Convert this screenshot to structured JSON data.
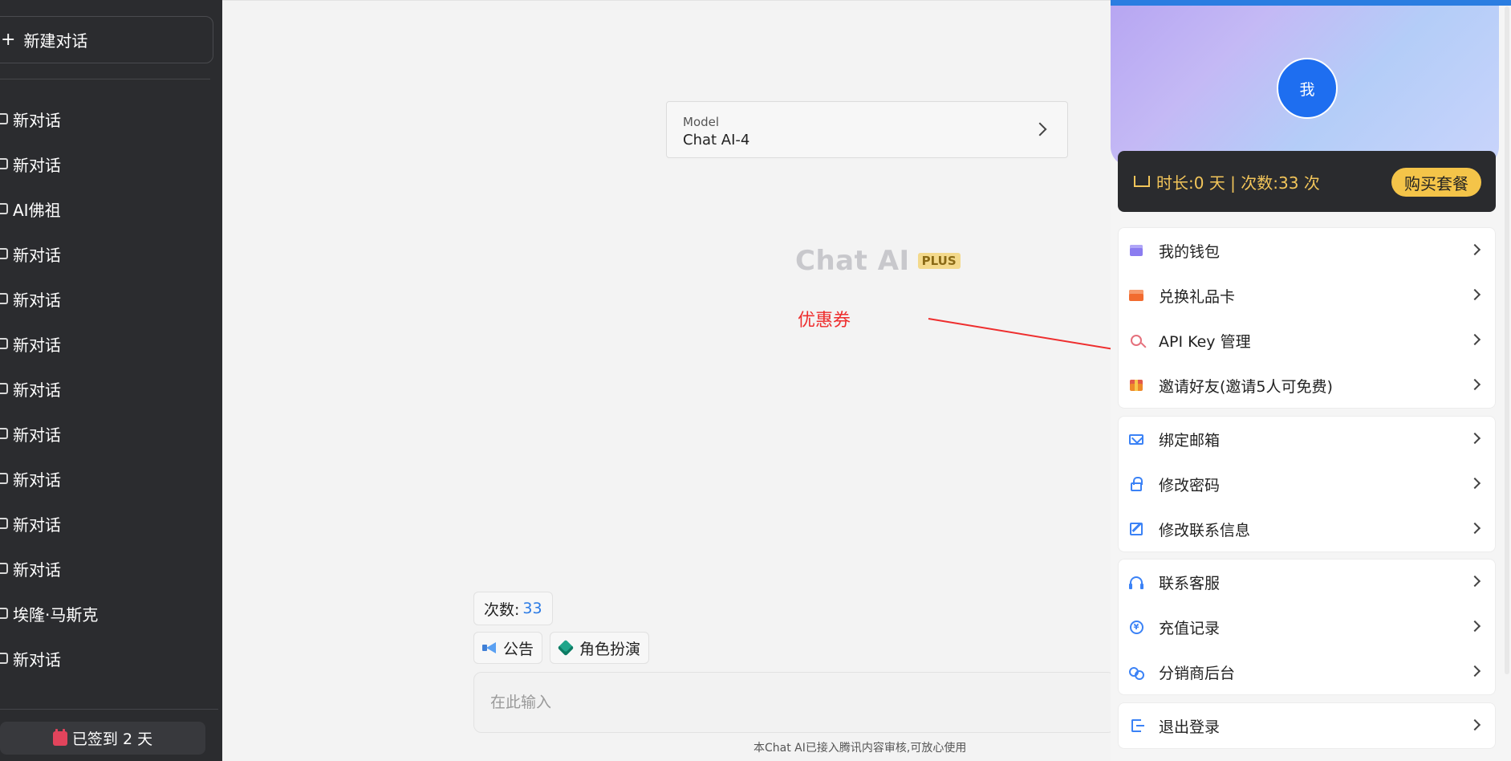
{
  "sidebar": {
    "new_chat_label": "新建对话",
    "new_chat_icon": "+",
    "chats": [
      "新对话",
      "新对话",
      "AI佛祖",
      "新对话",
      "新对话",
      "新对话",
      "新对话",
      "新对话",
      "新对话",
      "新对话",
      "新对话",
      "埃隆·马斯克",
      "新对话"
    ],
    "checkin_label": "已签到 2 天"
  },
  "main": {
    "model_label": "Model",
    "model_value": "Chat AI-4",
    "brand_title": "Chat AI",
    "brand_badge": "PLUS",
    "annotation": "优惠券",
    "count_label": "次数:",
    "count_value": "33",
    "announce_label": "公告",
    "role_label": "角色扮演",
    "input_placeholder": "在此输入",
    "footer_note": "本Chat AI已接入腾讯内容审核,可放心使用",
    "annotation_color": "#ee2e2e"
  },
  "panel": {
    "avatar_text": "我",
    "vip_text": "时长:0 天 | 次数:33 次",
    "buy_label": "购买套餐",
    "groups": [
      [
        {
          "label": "我的钱包",
          "icon": "wallet-icon"
        },
        {
          "label": "兑换礼品卡",
          "icon": "gift-card-icon"
        },
        {
          "label": "API Key 管理",
          "icon": "key-icon"
        },
        {
          "label": "邀请好友(邀请5人可免费)",
          "icon": "gift-icon"
        }
      ],
      [
        {
          "label": "绑定邮箱",
          "icon": "mail-icon"
        },
        {
          "label": "修改密码",
          "icon": "lock-icon"
        },
        {
          "label": "修改联系信息",
          "icon": "edit-icon"
        }
      ],
      [
        {
          "label": "联系客服",
          "icon": "headset-icon"
        },
        {
          "label": "充值记录",
          "icon": "yuan-icon"
        },
        {
          "label": "分销商后台",
          "icon": "people-icon"
        }
      ],
      [
        {
          "label": "退出登录",
          "icon": "logout-icon"
        }
      ]
    ],
    "accent_color": "#2a7de1",
    "vip_color": "#f2c55a"
  }
}
